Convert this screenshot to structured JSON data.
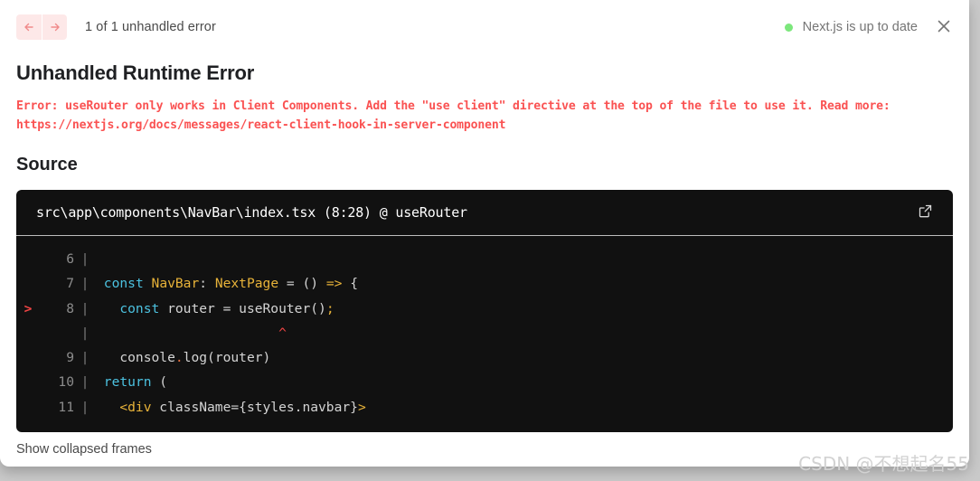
{
  "topbar": {
    "prev_icon": "arrow-left-icon",
    "next_icon": "arrow-right-icon",
    "error_count": "1 of 1 unhandled error",
    "version_status": "Next.js is up to date",
    "status_dot_color": "#7ce77c",
    "close_icon": "close-icon"
  },
  "error": {
    "title": "Unhandled Runtime Error",
    "message": "Error: useRouter only works in Client Components. Add the \"use client\" directive at the top of the file to use it. Read more: https://nextjs.org/docs/messages/react-client-hook-in-server-component",
    "message_color": "#fa5252"
  },
  "source": {
    "heading": "Source",
    "file_path": "src\\app\\components\\NavBar\\index.tsx (8:28) @ useRouter",
    "open_editor_icon": "external-link-icon",
    "lines": [
      {
        "marker": "",
        "number": "6",
        "bar": "|",
        "tokens": []
      },
      {
        "marker": "",
        "number": "7",
        "bar": "|",
        "tokens": [
          {
            "t": " ",
            "c": "tok-punc"
          },
          {
            "t": "const",
            "c": "tok-key"
          },
          {
            "t": " ",
            "c": "tok-punc"
          },
          {
            "t": "NavBar",
            "c": "tok-type"
          },
          {
            "t": ": ",
            "c": "tok-punc"
          },
          {
            "t": "NextPage",
            "c": "tok-type"
          },
          {
            "t": " = () ",
            "c": "tok-punc"
          },
          {
            "t": "=>",
            "c": "tok-arrow"
          },
          {
            "t": " {",
            "c": "tok-punc"
          }
        ]
      },
      {
        "marker": ">",
        "number": "8",
        "bar": "|",
        "tokens": [
          {
            "t": "   ",
            "c": "tok-punc"
          },
          {
            "t": "const",
            "c": "tok-key"
          },
          {
            "t": " router = useRouter()",
            "c": "tok-punc"
          },
          {
            "t": ";",
            "c": "tok-semi"
          }
        ]
      },
      {
        "marker": "",
        "number": "",
        "bar": "|",
        "tokens": [
          {
            "t": "                       ",
            "c": "tok-punc"
          },
          {
            "t": "^",
            "c": "caret-text"
          }
        ]
      },
      {
        "marker": "",
        "number": "9",
        "bar": "|",
        "tokens": [
          {
            "t": "   console",
            "c": "tok-punc"
          },
          {
            "t": ".",
            "c": "tok-dot"
          },
          {
            "t": "log(router)",
            "c": "tok-punc"
          }
        ]
      },
      {
        "marker": "",
        "number": "10",
        "bar": "|",
        "tokens": [
          {
            "t": " ",
            "c": "tok-punc"
          },
          {
            "t": "return",
            "c": "tok-key"
          },
          {
            "t": " (",
            "c": "tok-punc"
          }
        ]
      },
      {
        "marker": "",
        "number": "11",
        "bar": "|",
        "tokens": [
          {
            "t": "   ",
            "c": "tok-punc"
          },
          {
            "t": "<div",
            "c": "tok-tag"
          },
          {
            "t": " className={styles.navbar}",
            "c": "tok-punc"
          },
          {
            "t": ">",
            "c": "tok-tag"
          }
        ]
      }
    ]
  },
  "footer": {
    "collapsed_frames_label": "Show collapsed frames"
  },
  "watermark": {
    "text": "CSDN @不想起名55"
  }
}
